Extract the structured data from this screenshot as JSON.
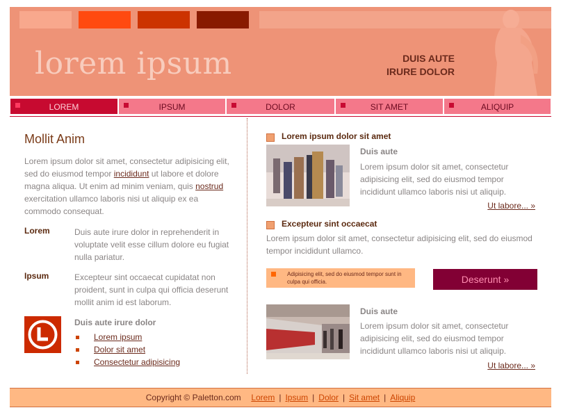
{
  "header": {
    "logo": "lorem ipsum",
    "tagline_line1": "DUIS AUTE",
    "tagline_line2": "IRURE DOLOR"
  },
  "nav": {
    "items": [
      {
        "label": "LOREM",
        "active": true
      },
      {
        "label": "IPSUM",
        "active": false
      },
      {
        "label": "DOLOR",
        "active": false
      },
      {
        "label": "SIT AMET",
        "active": false
      },
      {
        "label": "ALIQUIP",
        "active": false
      }
    ]
  },
  "left": {
    "title": "Mollit Anim",
    "intro": {
      "p1": "Lorem ipsum dolor sit amet, consectetur adipisicing elit, sed do eiusmod tempor ",
      "link1": "incididunt",
      "p2": " ut labore et dolore magna aliqua. Ut enim ad minim veniam, quis ",
      "link2": "nostrud",
      "p3": " exercitation ullamco laboris nisi ut aliquip ex ea commodo consequat."
    },
    "defs": [
      {
        "term": "Lorem",
        "desc": "Duis aute irure dolor in reprehenderit in voluptate velit esse cillum dolore eu fugiat nulla pariatur."
      },
      {
        "term": "Ipsum",
        "desc": "Excepteur sint occaecat cupidatat non proident, sunt in culpa qui officia deserunt mollit anim id est laborum."
      }
    ],
    "list_title": "Duis aute irure dolor",
    "list": [
      "Lorem ipsum",
      "Dolor sit amet",
      "Consectetur adipisicing"
    ]
  },
  "right": {
    "section1_title": "Lorem ipsum dolor sit amet",
    "article1_heading": "Duis aute",
    "article1_text": "Lorem ipsum dolor sit amet, consectetur adipisicing elit, sed do eiusmod tempor incididunt ullamco laboris nisi ut aliquip.",
    "article1_more": "Ut labore... »",
    "section2_title": "Excepteur sint occaecat",
    "section2_text": "Lorem ipsum dolor sit amet, consectetur adipisicing elit, sed do eiusmod tempor incididunt ullamco.",
    "callout_text": "Adipisicing elit, sed do eiusmod tempor sunt in culpa qui officia.",
    "cta_label": "Deserunt »",
    "article2_heading": "Duis aute",
    "article2_text": "Lorem ipsum dolor sit amet, consectetur adipisicing elit, sed do eiusmod tempor incididunt ullamco laboris nisi ut aliquip.",
    "article2_more": "Ut labore... »"
  },
  "footer": {
    "copyright": "Copyright © Paletton.com",
    "links": [
      "Lorem",
      "Ipsum",
      "Dolor",
      "Sit amet",
      "Aliquip"
    ]
  },
  "colors": {
    "header_bg": "#ee9377",
    "nav_bg": "#f4788a",
    "nav_active": "#c70a30",
    "cta_bg": "#820034",
    "footer_bg": "#ffb883"
  }
}
